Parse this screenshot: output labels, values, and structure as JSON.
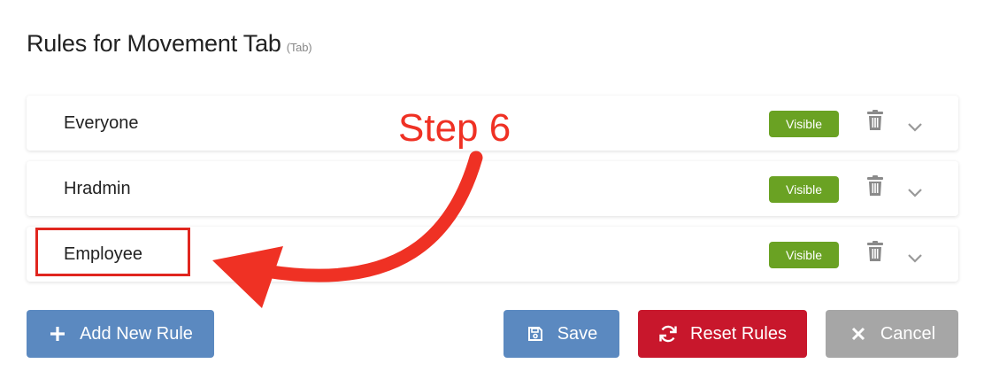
{
  "page": {
    "title": "Rules for Movement Tab",
    "subtitle": "(Tab)"
  },
  "rules": [
    {
      "name": "Everyone",
      "status": "Visible"
    },
    {
      "name": "Hradmin",
      "status": "Visible"
    },
    {
      "name": "Employee",
      "status": "Visible"
    }
  ],
  "icons": {
    "delete": "trash-icon",
    "expand": "chevron-down-icon",
    "add": "plus-icon",
    "save": "floppy-disk-icon",
    "reset": "refresh-icon",
    "cancel": "close-icon"
  },
  "buttons": {
    "add_label": "Add New Rule",
    "save_label": "Save",
    "reset_label": "Reset Rules",
    "cancel_label": "Cancel"
  },
  "annotation": {
    "step_label": "Step 6"
  },
  "colors": {
    "visible_badge": "#6aa223",
    "primary_button": "#5b89c0",
    "danger_button": "#c8172c",
    "neutral_button": "#a6a6a6",
    "annotation_red": "#ef3124"
  }
}
